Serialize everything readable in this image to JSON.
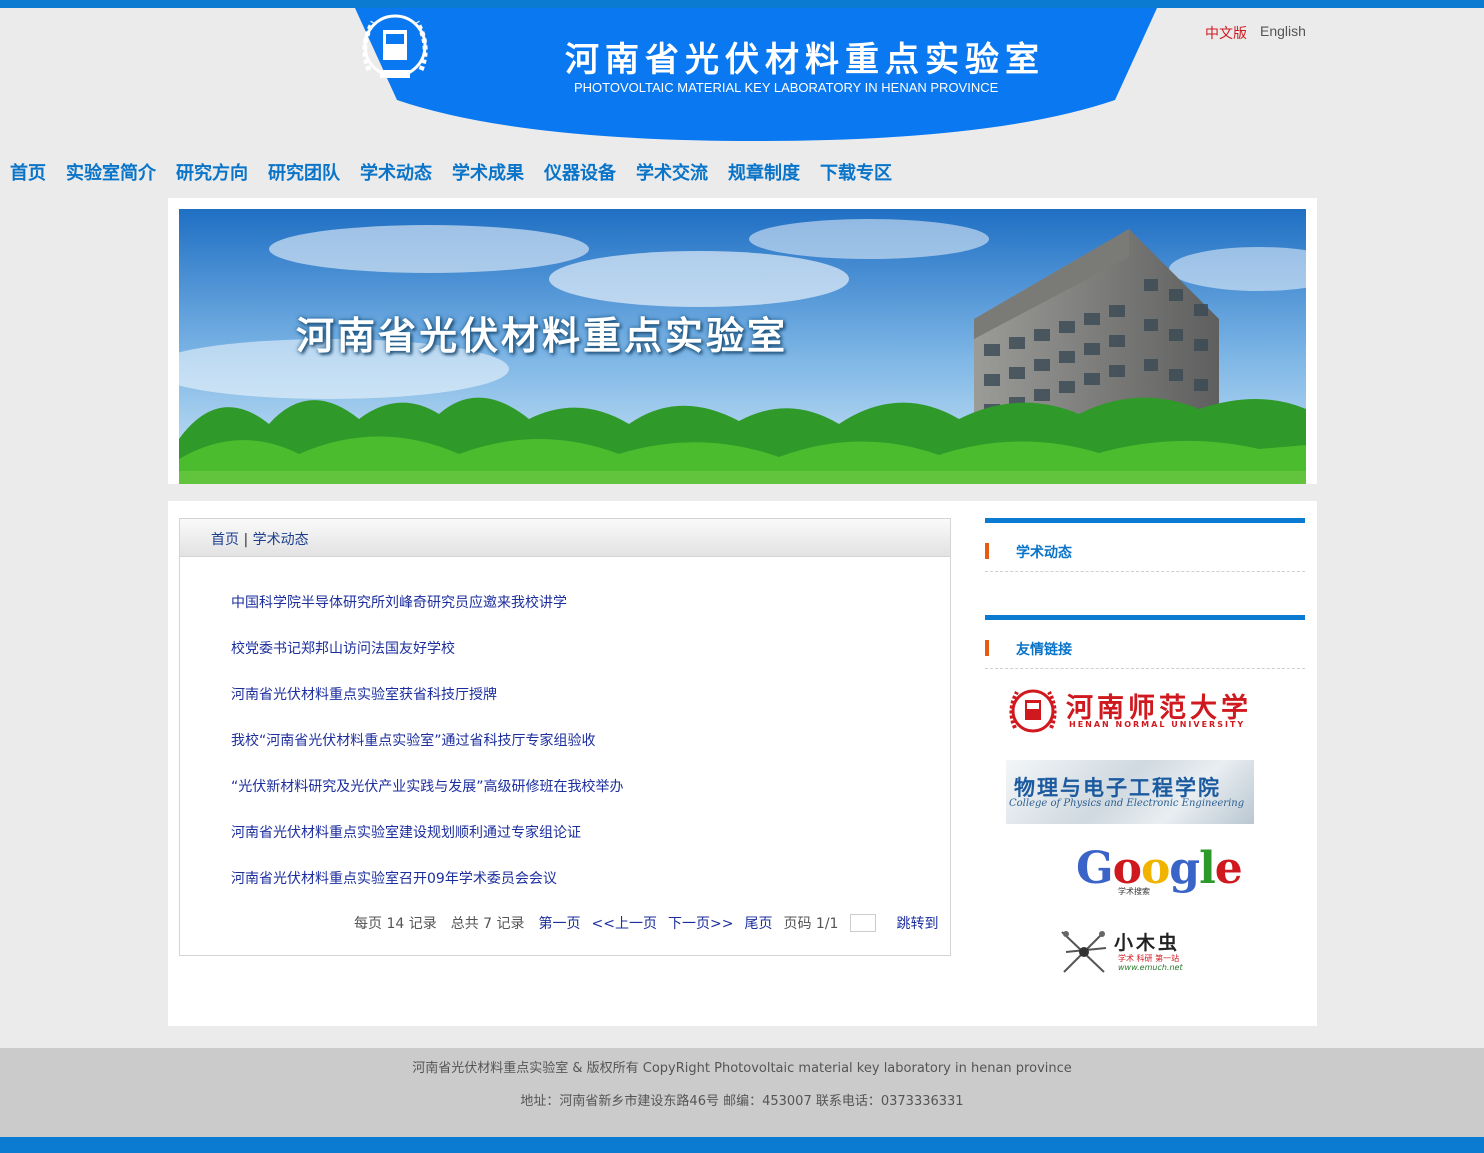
{
  "header": {
    "title": "河南省光伏材料重点实验室",
    "subtitle": "PHOTOVOLTAIC MATERIAL KEY LABORATORY IN HENAN PROVINCE",
    "lang_cn": "中文版",
    "lang_en": "English",
    "brand_color": "#0a7bd0"
  },
  "nav": {
    "items": [
      "首页",
      "实验室简介",
      "研究方向",
      "研究团队",
      "学术动态",
      "学术成果",
      "仪器设备",
      "学术交流",
      "规章制度",
      "下载专区"
    ]
  },
  "hero": {
    "title": "河南省光伏材料重点实验室"
  },
  "breadcrumb": {
    "home": "首页",
    "separator": "|",
    "current": "学术动态"
  },
  "news": [
    "中国科学院半导体研究所刘峰奇研究员应邀来我校讲学",
    "校党委书记郑邦山访问法国友好学校",
    "河南省光伏材料重点实验室获省科技厅授牌",
    "我校“河南省光伏材料重点实验室”通过省科技厅专家组验收",
    "“光伏新材料研究及光伏产业实践与发展”高级研修班在我校举办",
    "河南省光伏材料重点实验室建设规划顺利通过专家组论证",
    "河南省光伏材料重点实验室召开09年学术委员会会议"
  ],
  "pager": {
    "per_page": "每页 14 记录",
    "total": "总共 7 记录",
    "first": "第一页",
    "prev": "<<上一页",
    "next": "下一页>>",
    "last": "尾页",
    "page_info": "页码 1/1",
    "jump": "跳转到"
  },
  "sidebar": {
    "section1_title": "学术动态",
    "section2_title": "友情链接",
    "links": {
      "hnu_cn": "河南师范大学",
      "hnu_en": "HENAN NORMAL UNIVERSITY",
      "phys_cn": "物理与电子工程学院",
      "phys_en": "College of Physics and Electronic Engineering",
      "google_sub": "学术搜索",
      "emuch_cn": "小木虫",
      "emuch_sub": "学术 科研 第一站",
      "emuch_url": "www.emuch.net"
    }
  },
  "footer": {
    "copyright": "河南省光伏材料重点实验室 & 版权所有 CopyRight Photovoltaic material key laboratory in henan province",
    "address": "地址：河南省新乡市建设东路46号 邮编：453007 联系电话：0373336331"
  }
}
